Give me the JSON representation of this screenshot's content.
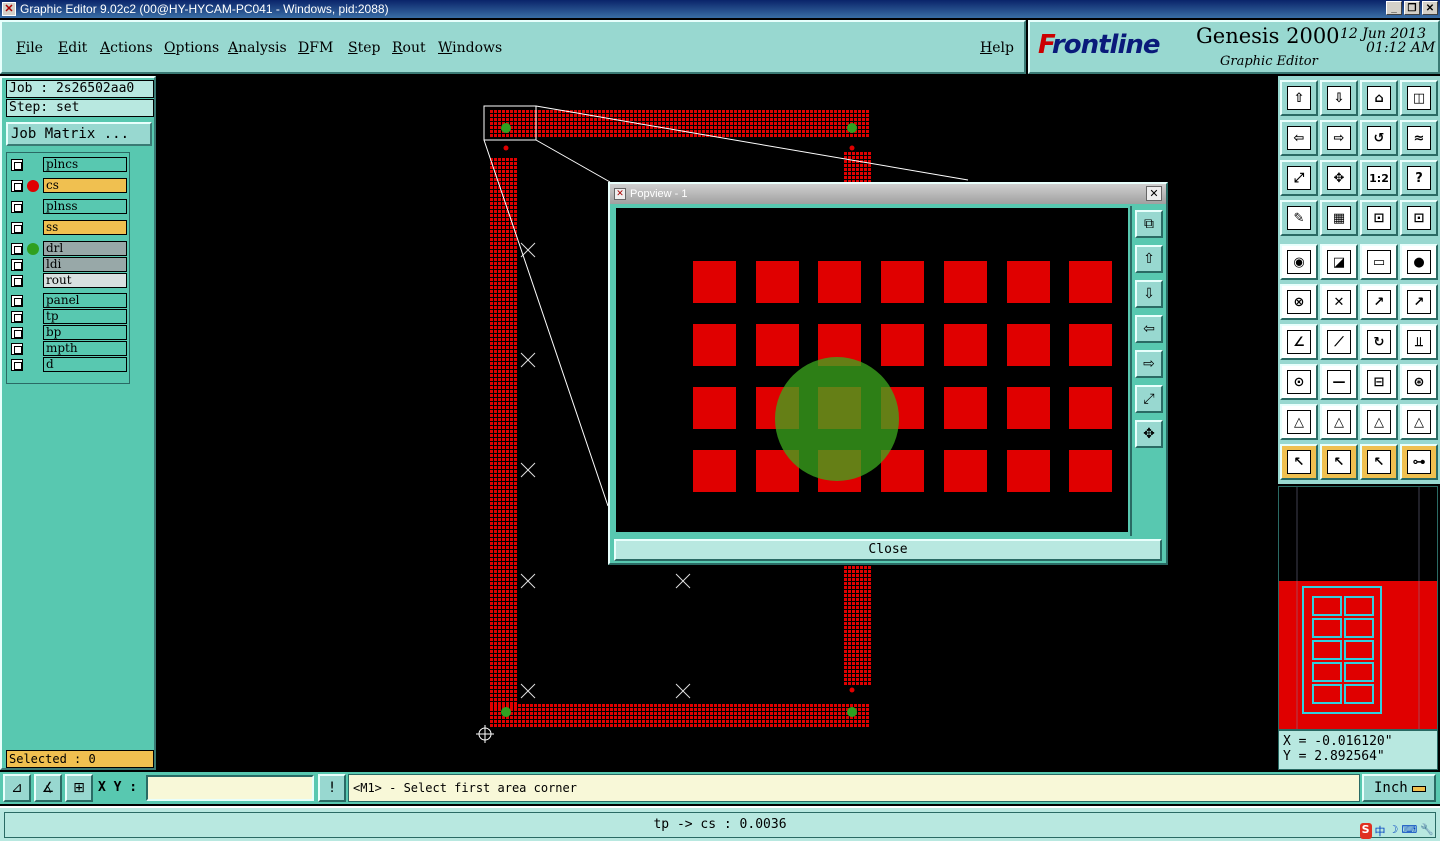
{
  "window": {
    "title": "Graphic Editor 9.02c2 (00@HY-HYCAM-PC041 - Windows, pid:2088)"
  },
  "menu": [
    "File",
    "Edit",
    "Actions",
    "Options",
    "Analysis",
    "DFM",
    "Step",
    "Rout",
    "Windows"
  ],
  "help": "Help",
  "brand": {
    "logo_mark": "F",
    "logo_rest": "rontline",
    "product": "Genesis 2000",
    "subtitle": "Graphic Editor",
    "date": "12 Jun 2013",
    "time": "01:12 AM"
  },
  "job": {
    "job_label": "Job : 2s26502aa0",
    "step_label": "Step: set",
    "matrix_button": "Job Matrix ..."
  },
  "layers": [
    {
      "name": "plncs",
      "color": "#58c8b0",
      "dot": ""
    },
    {
      "name": "cs",
      "color": "#f0c050",
      "dot": "#e00000"
    },
    {
      "name": "plnss",
      "color": "#58c8b0",
      "dot": ""
    },
    {
      "name": "ss",
      "color": "#f0c050",
      "dot": ""
    },
    {
      "name": "drl",
      "color": "#98a8a8",
      "dot": "#30a020"
    },
    {
      "name": "ldi",
      "color": "#98a8a8",
      "dot": ""
    },
    {
      "name": "rout",
      "color": "#d8e0e0",
      "dot": ""
    },
    {
      "name": "panel",
      "color": "#58c8b0",
      "dot": ""
    },
    {
      "name": "tp",
      "color": "#58c8b0",
      "dot": ""
    },
    {
      "name": "bp",
      "color": "#58c8b0",
      "dot": ""
    },
    {
      "name": "mpth",
      "color": "#58c8b0",
      "dot": ""
    },
    {
      "name": "d",
      "color": "#58c8b0",
      "dot": ""
    }
  ],
  "selected": "Selected : 0",
  "popview": {
    "title": "Popview - 1",
    "close": "Close"
  },
  "toolbar": {
    "zoom_ratio": "1:2",
    "help_glyph": "?"
  },
  "coords": {
    "x": "X = -0.016120\"",
    "y": "Y = 2.892564\""
  },
  "bottom": {
    "xy_label": "X Y :",
    "xy_value": "",
    "bang": "!",
    "prompt": "<M1> - Select first area corner",
    "unit": "Inch"
  },
  "status": "tp -> cs : 0.0036",
  "tray": {
    "s": "S",
    "zh": "中"
  },
  "colors": {
    "panel": "#58c8b0",
    "menu": "#98d8d0",
    "copper": "#e00000",
    "drill": "#30a020"
  }
}
